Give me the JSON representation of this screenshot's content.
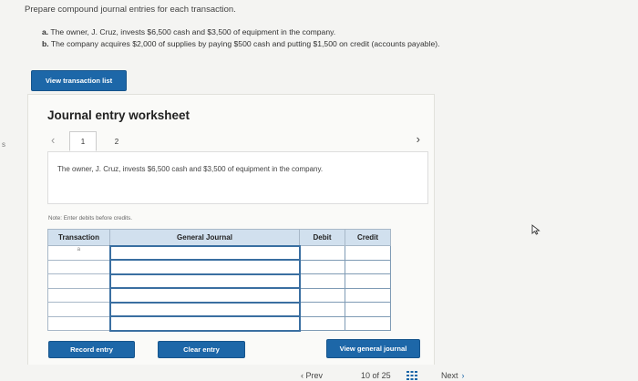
{
  "edge_mark": "s",
  "instructions": "Prepare compound journal entries for each transaction.",
  "transactions": [
    {
      "letter": "a.",
      "text": "The owner, J. Cruz, invests $6,500 cash and $3,500 of equipment in the company."
    },
    {
      "letter": "b.",
      "text": "The company acquires $2,000 of supplies by paying $500 cash and putting $1,500 on credit (accounts payable)."
    }
  ],
  "view_transaction_list_label": "View transaction list",
  "worksheet": {
    "title": "Journal entry worksheet",
    "prev_icon": "‹",
    "next_icon": "›",
    "pages": [
      "1",
      "2"
    ],
    "active_page": "1",
    "description": "The owner, J. Cruz, invests $6,500 cash and $3,500 of equipment in the company.",
    "note": "Note: Enter debits before credits.",
    "table": {
      "headers": {
        "transaction": "Transaction",
        "general_journal": "General Journal",
        "debit": "Debit",
        "credit": "Credit"
      },
      "first_row_transaction": "a",
      "row_count": 6
    },
    "buttons": {
      "record": "Record entry",
      "clear": "Clear entry",
      "view_general_journal": "View general journal"
    }
  },
  "bottom_nav": {
    "prev_label": "Prev",
    "page_current": "10",
    "page_of": "of",
    "page_total": "25",
    "next_label": "Next"
  },
  "colors": {
    "accent": "#1d67a8",
    "table_header": "#d1e0ee",
    "input_border": "#3a6fa1"
  },
  "icons": {
    "prev": "chevron-left-icon",
    "next": "chevron-right-icon",
    "grid": "grid-icon",
    "cursor": "mouse-cursor-icon"
  }
}
